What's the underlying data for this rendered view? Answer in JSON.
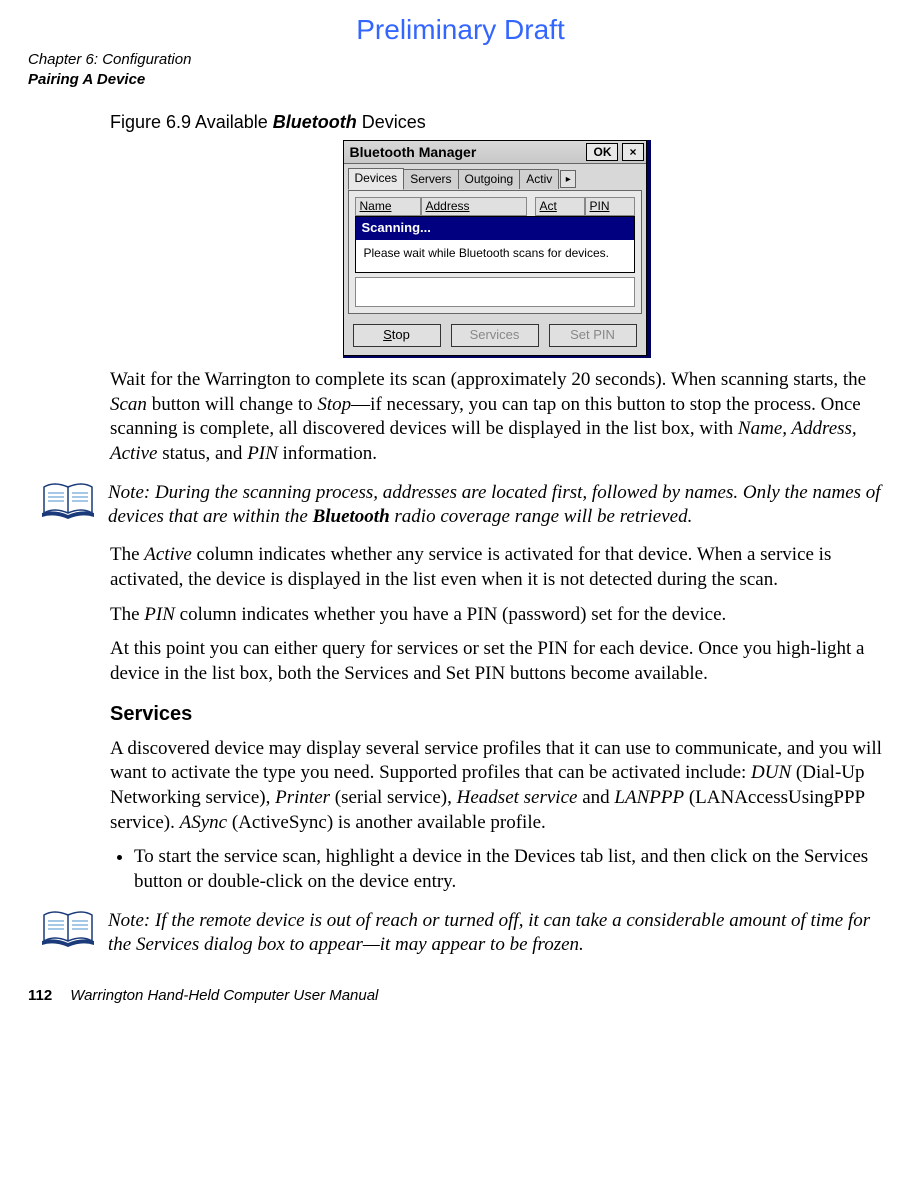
{
  "preliminary": "Preliminary Draft",
  "header": {
    "chapter": "Chapter 6:  Configuration",
    "section": "Pairing A Device"
  },
  "figure": {
    "caption_prefix": "Figure 6.9  Available ",
    "caption_bt": "Bluetooth",
    "caption_suffix": " Devices",
    "window_title": "Bluetooth Manager",
    "ok_button": "OK",
    "close_button": "×",
    "tabs": {
      "devices": "Devices",
      "servers": "Servers",
      "outgoing": "Outgoing",
      "active": "Activ"
    },
    "scroll_right": "▸",
    "cols": {
      "name": "Name",
      "address": "Address",
      "act": "Act",
      "pin": "PIN"
    },
    "scan_title": "Scanning...",
    "scan_body": "Please wait while Bluetooth scans for devices.",
    "btn_stop_pre": "S",
    "btn_stop_ul": "t",
    "btn_stop_post": "op",
    "btn_services": "Services",
    "btn_setpin": "Set PIN"
  },
  "para1_a": "Wait for the Warrington to complete its scan (approximately 20 seconds). When scanning starts, the ",
  "para1_b": "Scan",
  "para1_c": " button will change to ",
  "para1_d": "Stop",
  "para1_e": "—if necessary, you can tap on this button to stop the process. Once scanning is complete, all discovered devices will be displayed in the list box, with ",
  "para1_f": "Name, Address, Active",
  "para1_g": " status, and ",
  "para1_h": "PIN",
  "para1_i": " information.",
  "note1_a": "Note: During the scanning process, addresses are located first, followed by names. Only the names of devices that are within the ",
  "note1_b": "Bluetooth",
  "note1_c": " radio coverage range will be retrieved.",
  "para2_a": "The ",
  "para2_b": "Active",
  "para2_c": " column indicates whether any service is activated for that device. When a service is activated, the device is displayed in the list even when it is not detected during the scan.",
  "para3_a": "The ",
  "para3_b": "PIN",
  "para3_c": " column indicates whether you have a PIN (password) set for the device.",
  "para4": "At this point you can either query for services or set the PIN for each device. Once you high-light a device in the list box, both the Services and Set PIN buttons become available.",
  "subhead": "Services",
  "para5_a": "A discovered device may display several service profiles that it can use to communicate, and you will want to activate the type you need. Supported profiles that can be activated include: ",
  "para5_b": "DUN",
  "para5_c": " (Dial-Up Networking service), ",
  "para5_d": "Printer",
  "para5_e": " (serial service), ",
  "para5_f": "Headset service",
  "para5_g": " and ",
  "para5_h": "LANPPP",
  "para5_i": " (LANAccessUsingPPP service). ",
  "para5_j": "ASync",
  "para5_k": " (ActiveSync) is another available profile.",
  "bullet_a": "To start the service scan, highlight a device in the ",
  "bullet_b": "Devices",
  "bullet_c": " tab list, and then click on the ",
  "bullet_d": "Services",
  "bullet_e": " button or double-click on the device entry.",
  "note2": "Note: If the remote device is out of reach or turned off, it can take a considerable amount of time for the Services dialog box to appear—it may appear to be frozen.",
  "footer": {
    "page": "112",
    "title": "Warrington Hand-Held Computer User Manual"
  }
}
